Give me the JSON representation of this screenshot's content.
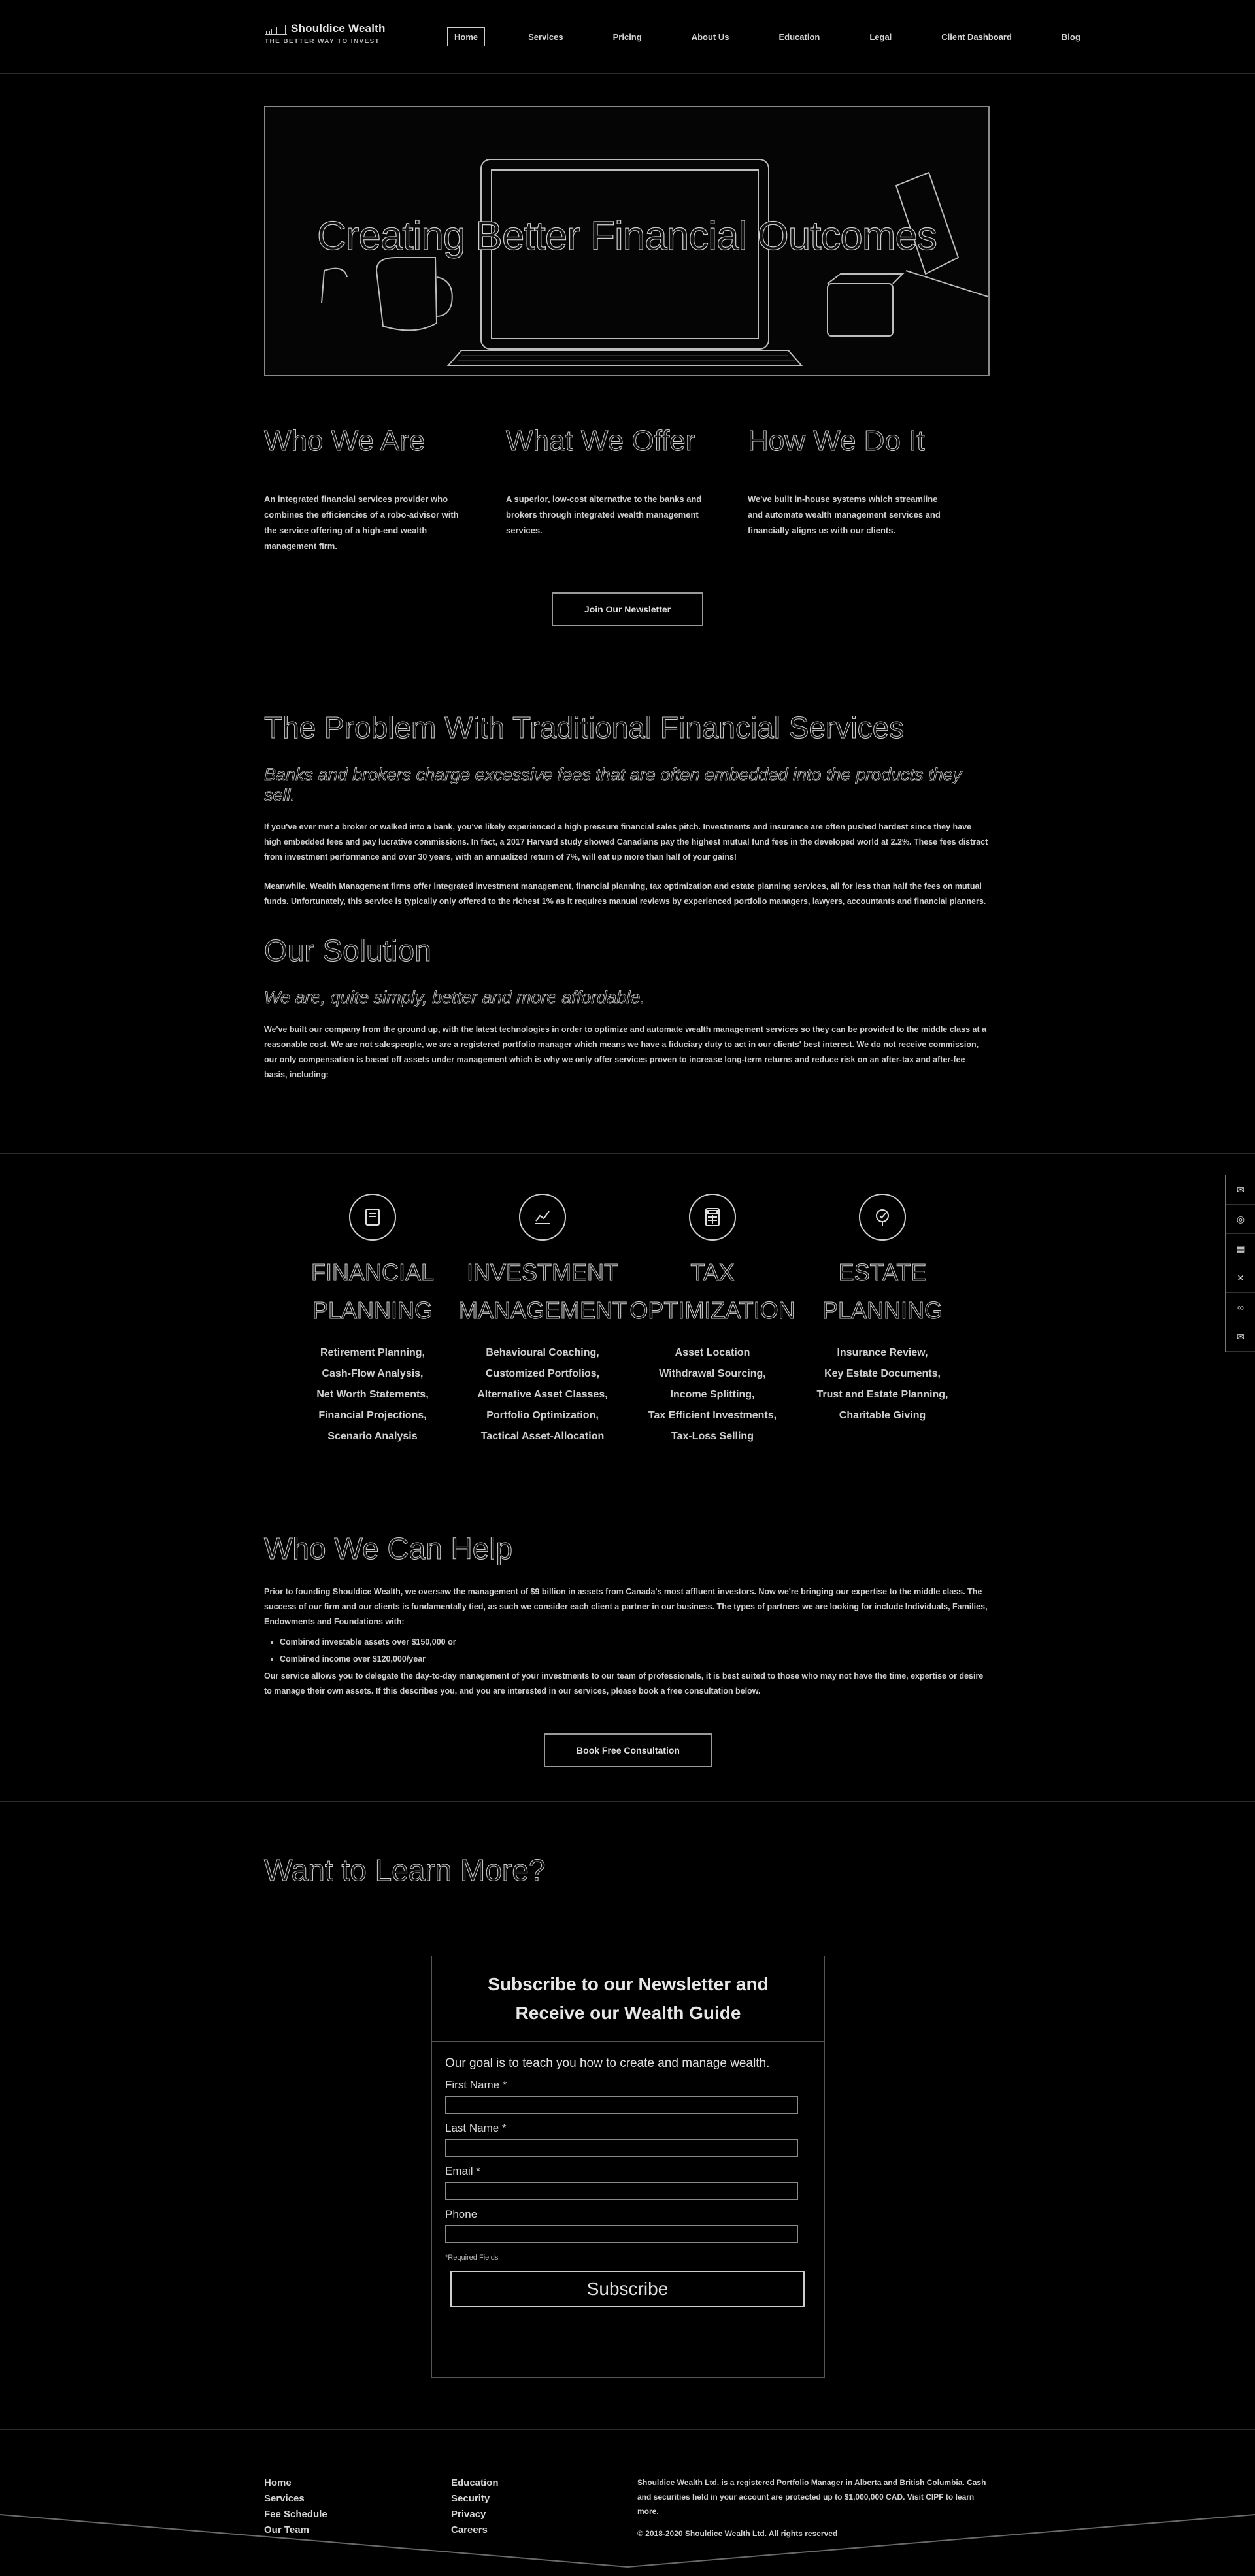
{
  "header": {
    "brand": "Shouldice Wealth",
    "tagline": "THE BETTER WAY TO INVEST",
    "nav": [
      "Home",
      "Services",
      "Pricing",
      "About Us",
      "Education",
      "Legal",
      "Client Dashboard",
      "Blog"
    ]
  },
  "hero": {
    "title": "Creating Better Financial Outcomes"
  },
  "intro": {
    "cols": [
      {
        "title": "Who We Are",
        "text": "An integrated financial services provider who combines the efficiencies of a robo-advisor with the service offering of a high-end wealth management firm."
      },
      {
        "title": "What We Offer",
        "text": "A superior, low-cost alternative to the banks and brokers through integrated wealth management services."
      },
      {
        "title": "How We Do It",
        "text": "We've built in-house systems which streamline and automate wealth management services and financially aligns us with our clients."
      }
    ],
    "newsletter_button": "Join Our Newsletter"
  },
  "problem": {
    "title": "The Problem With Traditional Financial Services",
    "subtitle": "Banks and brokers charge excessive fees that are often embedded into the products they sell.",
    "p1": "If you've ever met a broker or walked into a bank, you've likely experienced a high pressure financial sales pitch. Investments and insurance are often pushed hardest since they have high embedded fees and pay lucrative commissions. In fact, a 2017 Harvard study showed Canadians pay the highest mutual fund fees in the developed world at 2.2%. These fees distract from investment performance and over 30 years, with an annualized return of 7%, will eat up more than half of your gains!",
    "p2": "Meanwhile, Wealth Management firms offer integrated investment management, financial planning, tax optimization and estate planning services, all for less than half the fees on mutual funds. Unfortunately, this service is typically only offered to the richest 1% as it requires manual reviews by experienced portfolio managers, lawyers, accountants and financial planners."
  },
  "solution": {
    "title": "Our Solution",
    "subtitle": "We are, quite simply, better and more affordable.",
    "text": "We've built our company from the ground up, with the latest technologies in order to optimize and automate wealth management services so they can be provided to the middle class at a reasonable cost. We are not salespeople, we are a registered portfolio manager which means we have a fiduciary duty to act in our clients' best interest. We do not receive commission, our only compensation is based off assets under management which is why we only offer services proven to increase long-term returns and reduce risk on an after-tax and after-fee basis, including:"
  },
  "services": [
    {
      "icon": "book-icon",
      "title1": "FINANCIAL",
      "title2": "PLANNING",
      "items": [
        "Retirement Planning,",
        "Cash-Flow Analysis,",
        "Net Worth Statements,",
        "Financial Projections,",
        "Scenario Analysis"
      ]
    },
    {
      "icon": "chart-icon",
      "title1": "INVESTMENT",
      "title2": "MANAGEMENT",
      "items": [
        "Behavioural Coaching,",
        "Customized Portfolios,",
        "Alternative Asset Classes,",
        "Portfolio Optimization,",
        "Tactical Asset-Allocation"
      ]
    },
    {
      "icon": "calculator-icon",
      "title1": "TAX",
      "title2": "OPTIMIZATION",
      "items": [
        "Asset Location",
        "Withdrawal Sourcing,",
        "Income Splitting,",
        "Tax Efficient Investments,",
        "Tax-Loss Selling"
      ]
    },
    {
      "icon": "plan-icon",
      "title1": "ESTATE",
      "title2": "PLANNING",
      "items": [
        "Insurance Review,",
        "Key Estate Documents,",
        "Trust and Estate Planning,",
        "Charitable Giving"
      ]
    }
  ],
  "social": [
    "✉",
    "◎",
    "▦",
    "✕",
    "∞",
    "✉"
  ],
  "help": {
    "title": "Who We Can Help",
    "p1": "Prior to founding Shouldice Wealth, we oversaw the management of $9 billion in assets from Canada's most affluent investors. Now we're bringing our expertise to the middle class. The success of our firm and our clients is fundamentally tied, as such we consider each client a partner in our business. The types of partners we are looking for include Individuals, Families, Endowments and Foundations with:",
    "bullets": [
      "Combined investable assets over $150,000 or",
      "Combined income over $120,000/year"
    ],
    "p2": "Our service allows you to delegate the day-to-day management of your investments to our team of professionals, it is best suited to those who may not have the time, expertise or desire to manage their own assets. If this describes you, and you are interested in our services, please book a free consultation below.",
    "button": "Book Free Consultation"
  },
  "learn": {
    "title": "Want to Learn More?",
    "form_title": "Subscribe to our Newsletter and Receive our Wealth Guide",
    "goal": "Our goal is to teach you how to create and manage wealth.",
    "first_name": "First Name",
    "last_name": "Last Name",
    "email": "Email",
    "phone": "Phone",
    "required_star": "*",
    "required_note": "*Required Fields",
    "subscribe": "Subscribe"
  },
  "footer": {
    "col1": [
      "Home",
      "Services",
      "Fee Schedule",
      "Our Team"
    ],
    "col2": [
      "Education",
      "Security",
      "Privacy",
      "Careers"
    ],
    "note": "Shouldice Wealth Ltd. is a registered Portfolio Manager in Alberta and British Columbia. Cash and securities held in your account are protected up to $1,000,000 CAD. Visit CIPF to learn more.",
    "copyright": "© 2018-2020 Shouldice Wealth Ltd. All rights reserved"
  }
}
